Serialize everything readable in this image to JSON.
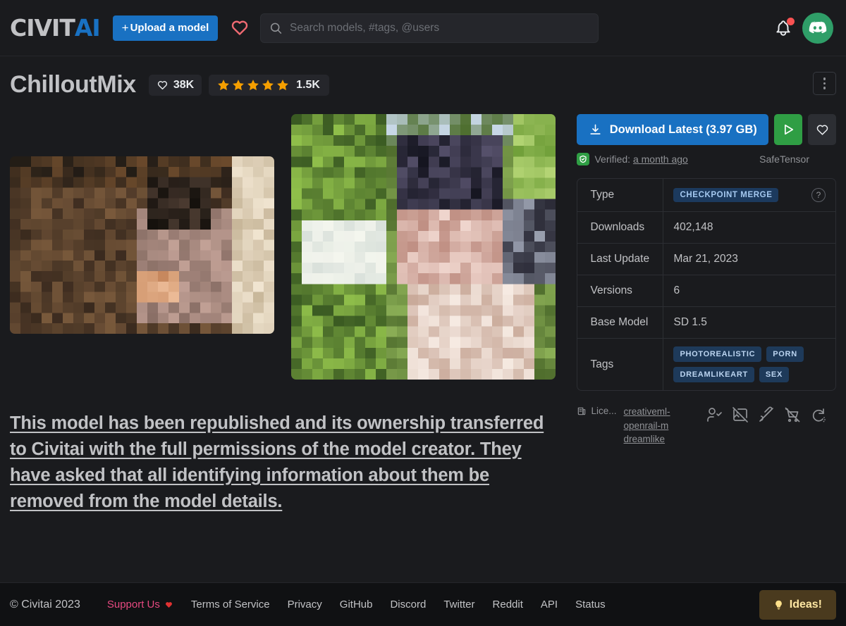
{
  "header": {
    "logo_primary": "CIVIT",
    "logo_accent": "AI",
    "upload_label": "Upload a model",
    "upload_plus": "+",
    "search_placeholder": "Search models, #tags, @users",
    "search_value": "",
    "accent_blue": "#1971C2",
    "heart_color": "#F06A72"
  },
  "model": {
    "title": "ChilloutMix",
    "likes": "38K",
    "rating_count": "1.5K",
    "stars_filled": 5,
    "star_color": "#F59F00"
  },
  "actions": {
    "download_label": "Download Latest (3.97 GB)",
    "verified_prefix": "Verified:",
    "verified_when": "a month ago",
    "format": "SafeTensor",
    "green": "#2F9E44"
  },
  "details": {
    "rows": [
      {
        "key": "Type",
        "type": "chip",
        "value": "CHECKPOINT MERGE",
        "help": "?"
      },
      {
        "key": "Downloads",
        "type": "text",
        "value": "402,148"
      },
      {
        "key": "Last Update",
        "type": "text",
        "value": "Mar 21, 2023"
      },
      {
        "key": "Versions",
        "type": "text",
        "value": "6"
      },
      {
        "key": "Base Model",
        "type": "text",
        "value": "SD 1.5"
      },
      {
        "key": "Tags",
        "type": "tags",
        "value": [
          "PHOTOREALISTIC",
          "PORN",
          "DREAMLIKEART",
          "SEX"
        ]
      }
    ]
  },
  "license": {
    "label": "Lice...",
    "link": "creativeml-openrail-m dreamlike",
    "permissions": [
      "user-check-icon",
      "photo-off-icon",
      "brush-off-icon",
      "shopping-cart-off-icon",
      "rotate-off-icon"
    ]
  },
  "description": {
    "text": "This model has been republished and its ownership transferred to Civitai with the full permissions of the model creator. They have asked that all identifying information about them be removed from the model details."
  },
  "footer": {
    "copyright": "© Civitai 2023",
    "links": [
      "Support Us",
      "Terms of Service",
      "Privacy",
      "GitHub",
      "Discord",
      "Twitter",
      "Reddit",
      "API",
      "Status"
    ],
    "ideas_label": "Ideas!"
  }
}
